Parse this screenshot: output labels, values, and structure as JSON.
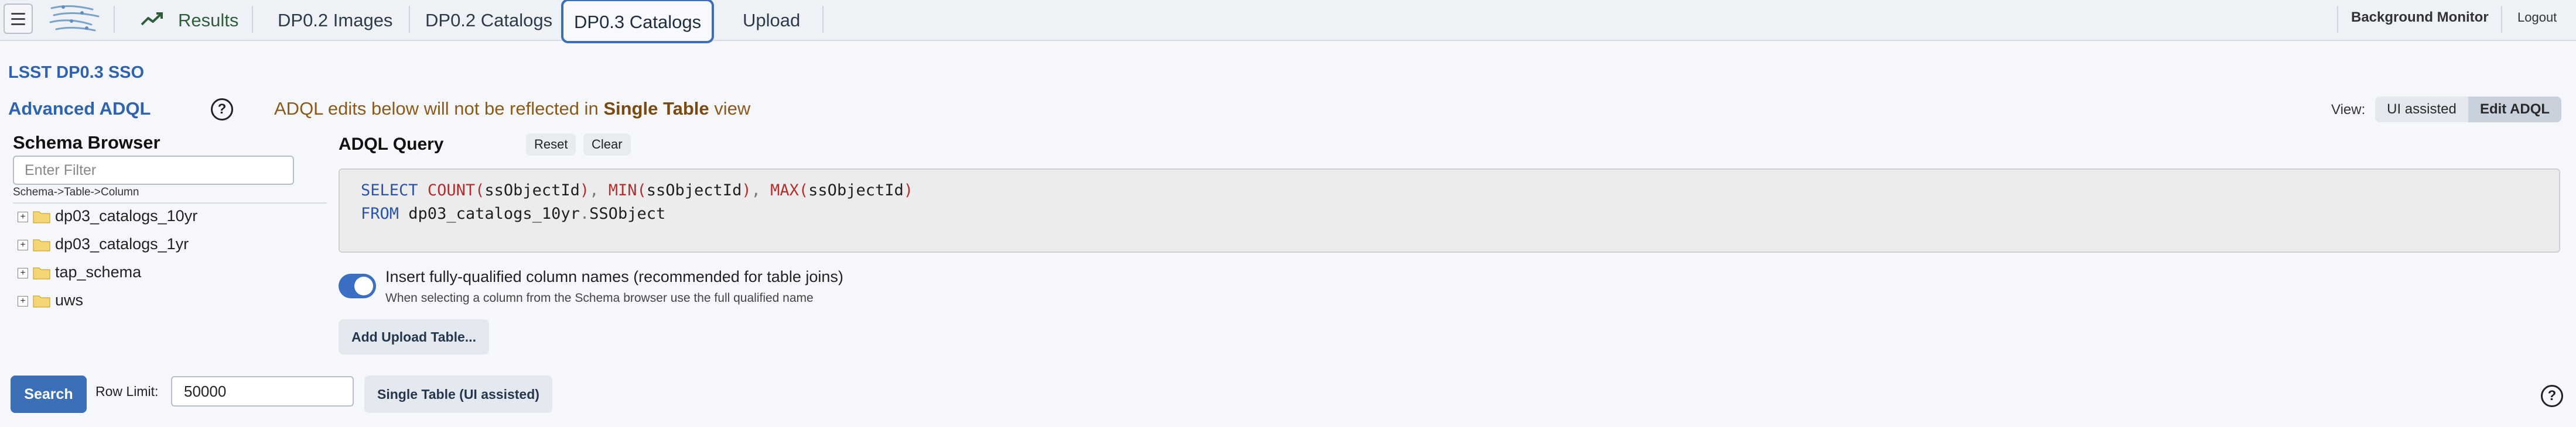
{
  "topbar": {
    "tabs": [
      {
        "label": "Results"
      },
      {
        "label": "DP0.2 Images"
      },
      {
        "label": "DP0.2 Catalogs"
      },
      {
        "label": "DP0.3 Catalogs"
      },
      {
        "label": "Upload"
      }
    ],
    "active_tab": "DP0.3 Catalogs",
    "background_monitor": "Background Monitor",
    "logout": "Logout"
  },
  "service_title": "LSST DP0.3 SSO",
  "advanced": {
    "title": "Advanced ADQL",
    "help_icon": "?",
    "note_prefix": "ADQL edits below will not be reflected in ",
    "note_bold": "Single Table",
    "note_suffix": " view"
  },
  "view": {
    "label": "View:",
    "options": [
      "UI assisted",
      "Edit ADQL"
    ],
    "selected": "Edit ADQL"
  },
  "schema_browser": {
    "title": "Schema Browser",
    "filter_placeholder": "Enter Filter",
    "path_label": "Schema->Table->Column",
    "items": [
      {
        "label": "dp03_catalogs_10yr"
      },
      {
        "label": "dp03_catalogs_1yr"
      },
      {
        "label": "tap_schema"
      },
      {
        "label": "uws"
      }
    ]
  },
  "adql": {
    "label": "ADQL Query",
    "reset": "Reset",
    "clear": "Clear",
    "line1": {
      "select": "SELECT",
      "count": "COUNT",
      "min": "MIN",
      "max": "MAX",
      "col": "ssObjectId"
    },
    "line2": {
      "from": "FROM",
      "schema": "dp03_catalogs_10yr",
      "table": "SSObject"
    }
  },
  "toggle": {
    "label": "Insert fully-qualified column names (recommended for table joins)",
    "sublabel": "When selecting a column from the Schema browser use the full qualified name",
    "on": true
  },
  "add_upload_label": "Add Upload Table...",
  "footer": {
    "search": "Search",
    "row_limit_label": "Row Limit:",
    "row_limit_value": "50000",
    "single_table": "Single Table (UI assisted)",
    "help_icon": "?"
  },
  "colors": {
    "accent": "#3b6fb6",
    "title_blue": "#2f63b0",
    "note_brown": "#8a5a1a"
  }
}
